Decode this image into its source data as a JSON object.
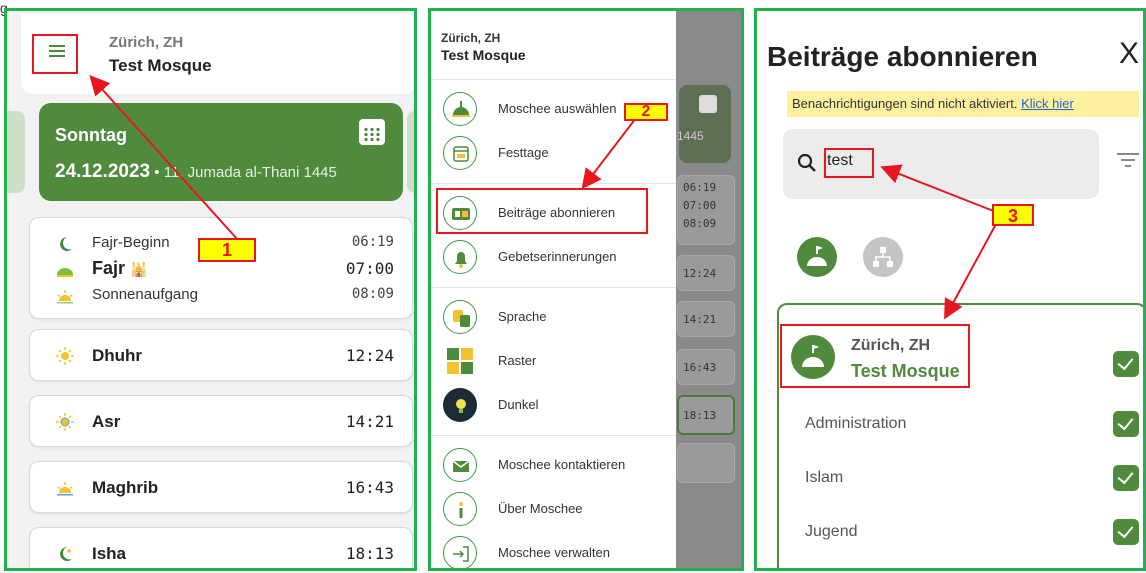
{
  "top_fragment": "g",
  "panel1": {
    "city": "Zürich, ZH",
    "mosque": "Test Mosque",
    "date_card": {
      "day": "Sonntag",
      "date": "24.12.2023",
      "separator": "•",
      "hijri": "11. Jumada al-Thani 1445"
    },
    "fajr_group": [
      {
        "name": "Fajr-Beginn",
        "time": "06:19",
        "icon": "crescent-moon-icon"
      },
      {
        "name": "Fajr",
        "time": "07:00",
        "icon": "dome-icon",
        "suffix": "🕌"
      },
      {
        "name": "Sonnenaufgang",
        "time": "08:09",
        "icon": "sunrise-icon"
      }
    ],
    "prayers": [
      {
        "name": "Dhuhr",
        "time": "12:24",
        "icon": "sun-icon"
      },
      {
        "name": "Asr",
        "time": "14:21",
        "icon": "sun-icon"
      },
      {
        "name": "Maghrib",
        "time": "16:43",
        "icon": "sunset-icon"
      },
      {
        "name": "Isha",
        "time": "18:13",
        "icon": "crescent-star-icon"
      }
    ]
  },
  "panel2": {
    "city": "Zürich, ZH",
    "mosque": "Test Mosque",
    "menu": [
      {
        "label": "Moschee auswählen",
        "icon": "mosque-icon"
      },
      {
        "label": "Festtage",
        "icon": "calendar-icon"
      },
      {
        "label": "Beiträge abonnieren",
        "icon": "subscribe-icon"
      },
      {
        "label": "Gebetserinnerungen",
        "icon": "bell-icon"
      },
      {
        "label": "Sprache",
        "icon": "translate-icon"
      },
      {
        "label": "Raster",
        "icon": "grid-icon"
      },
      {
        "label": "Dunkel",
        "icon": "bulb-icon"
      },
      {
        "label": "Moschee kontaktieren",
        "icon": "mail-icon"
      },
      {
        "label": "Über Moschee",
        "icon": "info-icon"
      },
      {
        "label": "Moschee verwalten",
        "icon": "login-icon"
      }
    ],
    "background_year": "1445",
    "background_times": [
      "06:19",
      "07:00",
      "08:09",
      "12:24",
      "14:21",
      "16:43",
      "18:13"
    ]
  },
  "panel3": {
    "title": "Beiträge abonnieren",
    "close": "X",
    "notice": "Benachrichtigungen sind nicht aktiviert.",
    "notice_link": "Klick hier",
    "search_value": "test",
    "subscription": {
      "city": "Zürich, ZH",
      "mosque": "Test Mosque",
      "checked": true,
      "categories": [
        {
          "label": "Administration",
          "checked": true
        },
        {
          "label": "Islam",
          "checked": true
        },
        {
          "label": "Jugend",
          "checked": true
        }
      ]
    }
  },
  "annotations": [
    "1",
    "2",
    "3"
  ],
  "colors": {
    "brand_green": "#4f8a3d",
    "frame_green": "#22b14c",
    "annotation_red": "#e8161f",
    "annotation_yellow": "#ffff00",
    "notice_yellow": "#fdf0a0"
  }
}
